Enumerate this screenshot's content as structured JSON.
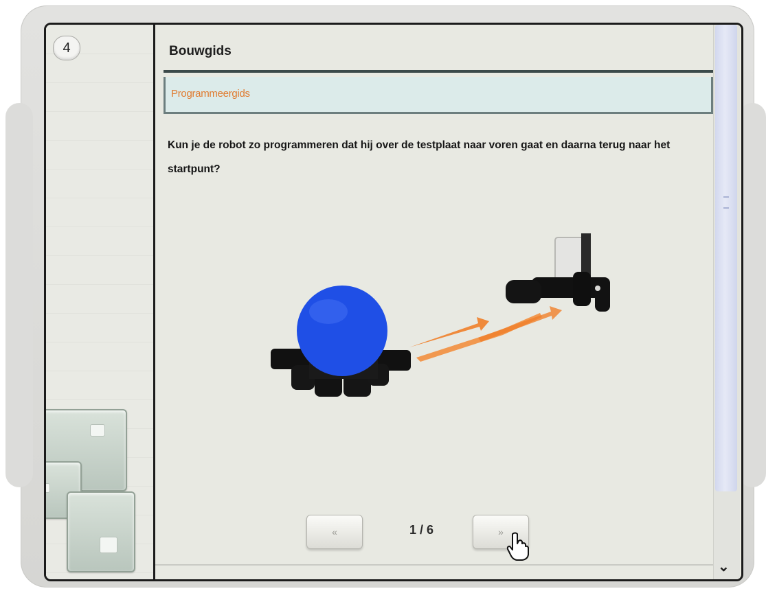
{
  "window": {
    "step_number": "4",
    "title": "Bouwgids",
    "section_header": "Programmeergids",
    "question": "Kun je de robot zo programmeren dat hij over de testplaat naar voren gaat en daarna terug naar het startpunt?"
  },
  "navigation": {
    "prev_label": "«",
    "next_label": "»",
    "page_indicator": "1 / 6"
  },
  "icons": {
    "scroll_down": "chevron-down-icon",
    "cursor": "hand-pointer-icon"
  },
  "colors": {
    "section_header_text": "#e07a2e",
    "ball": "#1f4fe6",
    "arrow": "#f07f2a"
  }
}
